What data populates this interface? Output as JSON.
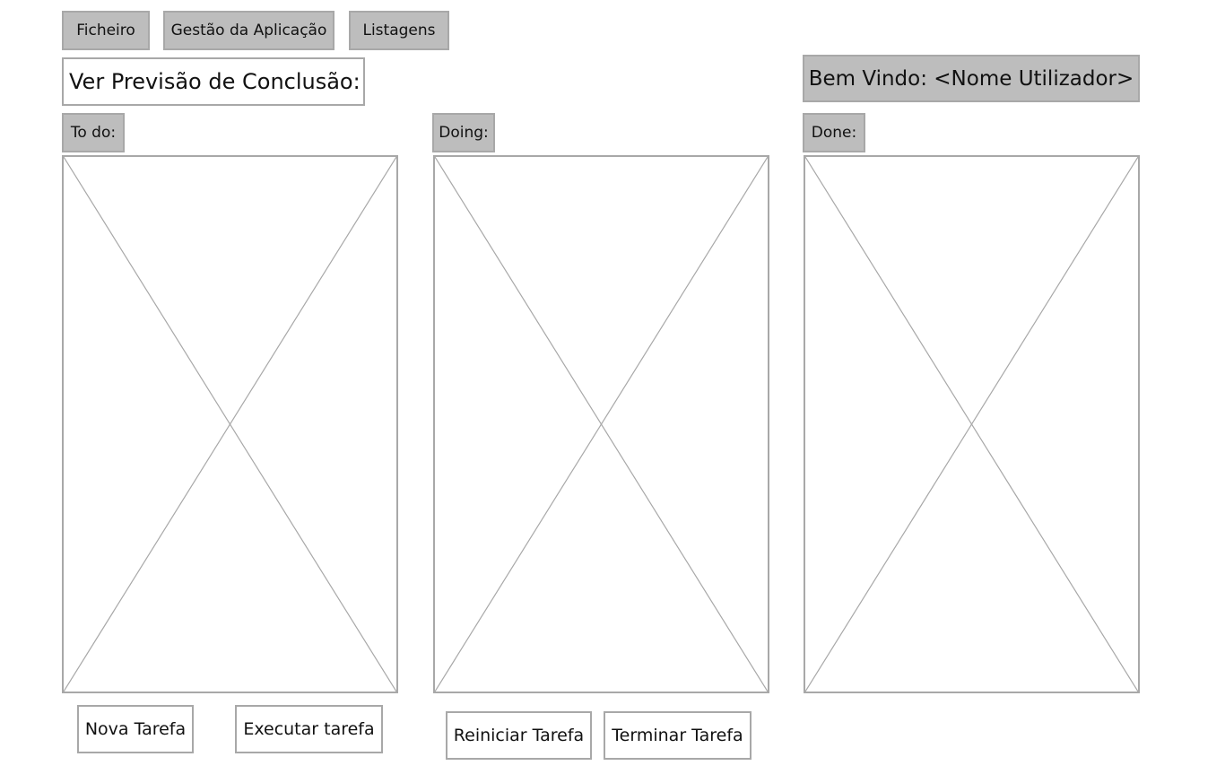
{
  "menu": {
    "ficheiro": "Ficheiro",
    "gestao": "Gestão da Aplicação",
    "listagens": "Listagens"
  },
  "header": {
    "previsao": "Ver Previsão de Conclusão:",
    "welcome": "Bem Vindo: <Nome Utilizador>"
  },
  "columns": {
    "todo": "To do:",
    "doing": "Doing:",
    "done": "Done:"
  },
  "actions": {
    "nova": "Nova Tarefa",
    "executar": "Executar tarefa",
    "reiniciar": "Reiniciar Tarefa",
    "terminar": "Terminar Tarefa"
  },
  "colors": {
    "gray_fill": "#bdbdbd",
    "border": "#a8a8a8"
  }
}
